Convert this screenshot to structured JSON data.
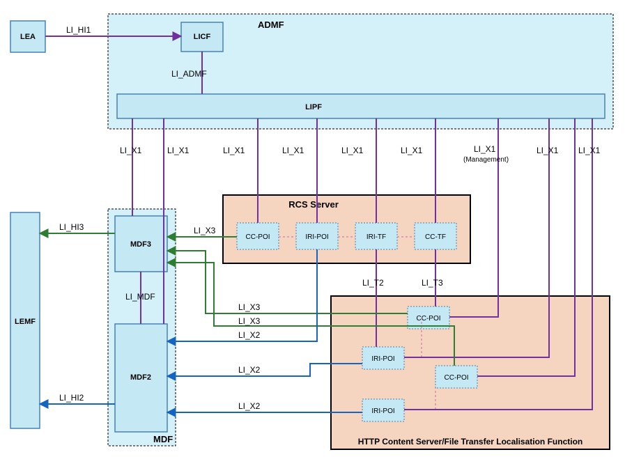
{
  "boxes": {
    "lea": "LEA",
    "licf": "LICF",
    "admf_title": "ADMF",
    "lipf": "LIPF",
    "lemf": "LEMF",
    "mdf3": "MDF3",
    "mdf2": "MDF2",
    "mdf_title": "MDF",
    "rcs_title": "RCS Server",
    "http_title": "HTTP Content Server/File Transfer Localisation Function",
    "cc_poi": "CC-POI",
    "iri_poi": "IRI-POI",
    "iri_tf": "IRI-TF",
    "cc_tf": "CC-TF"
  },
  "labels": {
    "li_hi1": "LI_HI1",
    "li_hi2": "LI_HI2",
    "li_hi3": "LI_HI3",
    "li_admf": "LI_ADMF",
    "li_mdf": "LI_MDF",
    "li_x1": "LI_X1",
    "li_x1_mgmt_a": "LI_X1",
    "li_x1_mgmt_b": "(Management)",
    "li_x2": "LI_X2",
    "li_x3": "LI_X3",
    "li_t2": "LI_T2",
    "li_t3": "LI_T3"
  }
}
